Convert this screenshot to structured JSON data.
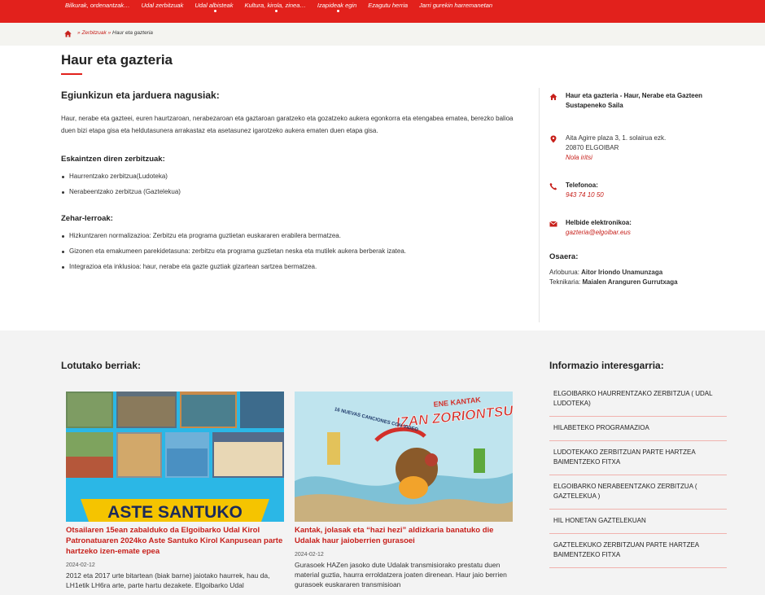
{
  "topnav": {
    "items": [
      "Bilkurak, ordenantzak…",
      "Udal zerbitzuak",
      "Udal albisteak",
      "Kultura, kirola, zinea…",
      "Izapideak egin",
      "Ezagutu herria",
      "Jarri gurekin harremanetan"
    ]
  },
  "breadcrumb": {
    "sep": "»",
    "link": "Zerbitzuak",
    "current": "Haur eta gazteria"
  },
  "page": {
    "title": "Haur eta gazteria"
  },
  "main": {
    "heading": "Egiunkizun eta jarduera nagusiak:",
    "body": "Haur, nerabe eta gazteei, euren haurtzaroan, nerabezaroan eta gaztaroan garatzeko eta gozatzeko aukera egonkorra eta etengabea ematea, berezko balioa duen bizi etapa gisa eta heldutasunera arrakastaz eta asetasunez igarotzeko aukera ematen duen etapa gisa.",
    "services_heading": "Eskaintzen diren zerbitzuak:",
    "services": [
      "Haurrentzako zerbitzua(Ludoteka)",
      "Nerabeentzako zerbitzua (Gaztelekua)"
    ],
    "cross_heading": "Zehar-lerroak:",
    "cross": [
      "Hizkuntzaren normalizazioa: Zerbitzu eta programa guztietan euskararen erabilera bermatzea.",
      "Gizonen eta emakumeen parekidetasuna: zerbitzu eta programa guztietan neska eta mutilek aukera berberak izatea.",
      "Integrazioa eta inklusioa: haur, nerabe eta gazte guztiak gizartean sartzea bermatzea."
    ]
  },
  "contact": {
    "dept": "Haur eta gazteria - Haur, Nerabe eta Gazteen Sustapeneko Saila",
    "address_line1": "Aita Agirre plaza 3, 1. solairua ezk.",
    "address_line2": "20870 ELGOIBAR",
    "directions": "Nola iritsi",
    "phone_label": "Telefonoa:",
    "phone": "943 74 10 50",
    "email_label": "Helbide elektronikoa:",
    "email": "gazteria@elgoibar.eus",
    "staff_heading": "Osaera:",
    "staff": [
      {
        "role": "Arloburua:",
        "name": "Aitor Iriondo Unamunzaga"
      },
      {
        "role": "Teknikaria:",
        "name": "Maialen Aranguren Gurrutxaga"
      }
    ]
  },
  "news": {
    "heading": "Lotutako berriak:",
    "cards": [
      {
        "banner": "ASTE SANTUKO",
        "title": "Otsailaren 15ean zabalduko da Elgoibarko Udal Kirol Patronatuaren 2024ko Aste Santuko Kirol Kanpusean parte hartzeko izen-emate epea",
        "date": "2024-02-12",
        "text": "2012 eta 2017 urte bitartean (biak barne) jaiotako haurrek, hau da, LH1etik LH6ra arte, parte hartu dezakete. Elgoibarko Udal"
      },
      {
        "banner_top": "ENE KANTAK",
        "banner_main": "IZAN ZORIONTSU!",
        "banner_sub": "16 NUEVAS CANCIONES CON VIDEO",
        "title": "Kantak, jolasak eta “hazi hezi” aldizkaria banatuko die Udalak haur jaioberrien gurasoei",
        "date": "2024-02-12",
        "text": "Gurasoek HAZen jasoko dute Udalak transmisiorako prestatu duen material guztia, haurra erroldatzera joaten direnean. Haur jaio berrien gurasoek euskararen transmisioan"
      }
    ]
  },
  "info": {
    "heading": "Informazio interesgarria:",
    "items": [
      "ELGOIBARKO HAURRENTZAKO ZERBITZUA ( UDAL LUDOTEKA)",
      "HILABETEKO PROGRAMAZIOA",
      "LUDOTEKAKO ZERBITZUAN PARTE HARTZEA BAIMENTZEKO FITXA",
      "ELGOIBARKO NERABEENTZAKO ZERBITZUA ( GAZTELEKUA )",
      "HIL HONETAN GAZTELEKUAN",
      "GAZTELEKUKO ZERBITZUAN PARTE HARTZEA BAIMENTZEKO FITXA"
    ]
  },
  "colors": {
    "brand_red": "#e2211c",
    "link_red": "#c7201b"
  }
}
